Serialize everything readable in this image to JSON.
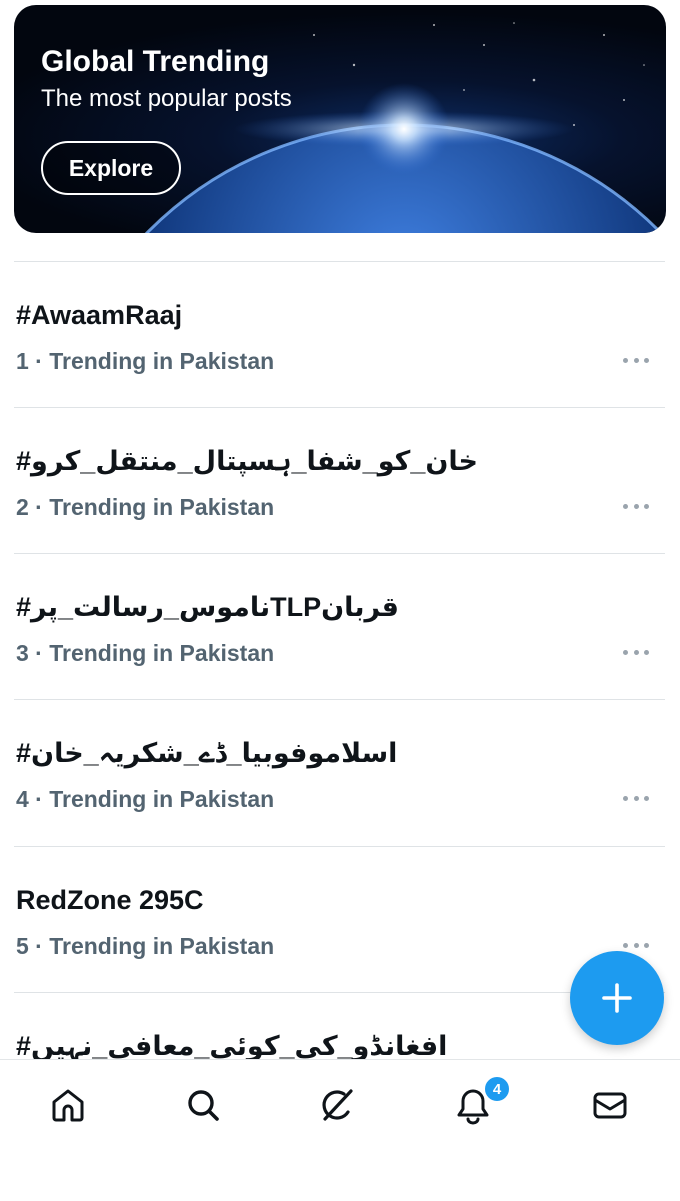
{
  "banner": {
    "title": "Global Trending",
    "subtitle": "The most popular posts",
    "explore_label": "Explore"
  },
  "trends": [
    {
      "title": "#AwaamRaaj",
      "meta": "1 · Trending in Pakistan"
    },
    {
      "title": "#خان_کو_شفا_ہسپتال_منتقل_کرو",
      "meta": "2 · Trending in Pakistan"
    },
    {
      "title": "#ناموس_رسالت_پرTLPقربان",
      "meta": "3 · Trending in Pakistan"
    },
    {
      "title": "#اسلاموفوبیا_ڈے_شکریہ_خان",
      "meta": "4 · Trending in Pakistan"
    },
    {
      "title": "RedZone 295C",
      "meta": "5 · Trending in Pakistan"
    },
    {
      "title": "#افغانڈو_کی_کوئی_معافی_نہیں",
      "meta": ""
    }
  ],
  "fab": {
    "icon": "plus-icon",
    "color": "#1d9bf0"
  },
  "bottom_nav": {
    "items": [
      {
        "icon": "home-icon"
      },
      {
        "icon": "search-icon"
      },
      {
        "icon": "grok-icon"
      },
      {
        "icon": "bell-icon"
      },
      {
        "icon": "mail-icon"
      }
    ],
    "notifications_badge": "4"
  },
  "colors": {
    "accent": "#1d9bf0",
    "secondary_text": "#536471"
  }
}
